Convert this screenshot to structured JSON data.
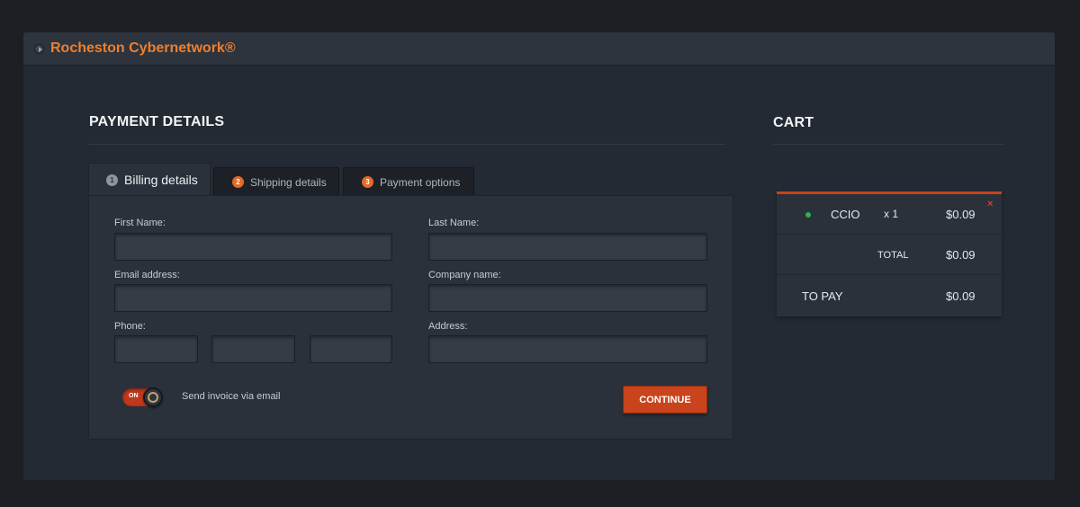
{
  "header": {
    "brand": "Rocheston Cybernetwork®"
  },
  "payment": {
    "title": "PAYMENT DETAILS",
    "tabs": [
      {
        "number": "1",
        "label": "Billing details"
      },
      {
        "number": "2",
        "label": "Shipping details"
      },
      {
        "number": "3",
        "label": "Payment options"
      }
    ],
    "fields": {
      "first_name_label": "First Name:",
      "last_name_label": "Last Name:",
      "email_label": "Email address:",
      "company_label": "Company name:",
      "phone_label": "Phone:",
      "address_label": "Address:",
      "first_name_value": "",
      "last_name_value": "",
      "email_value": "",
      "company_value": "",
      "phone_value_1": "",
      "phone_value_2": "",
      "phone_value_3": "",
      "address_value": ""
    },
    "toggle": {
      "state_text": "ON",
      "label": "Send invoice via email"
    },
    "continue_label": "CONTINUE"
  },
  "cart": {
    "title": "CART",
    "item": {
      "name": "CCIO",
      "quantity": "x 1",
      "price": "$0.09"
    },
    "total_label": "TOTAL",
    "total_value": "$0.09",
    "to_pay_label": "TO PAY",
    "to_pay_value": "$0.09",
    "remove_icon": "×"
  },
  "colors": {
    "accent": "#ee7f2d",
    "button": "#c9431c",
    "status_dot": "#2db34a",
    "background": "#1c1f24",
    "panel": "#242a33"
  }
}
